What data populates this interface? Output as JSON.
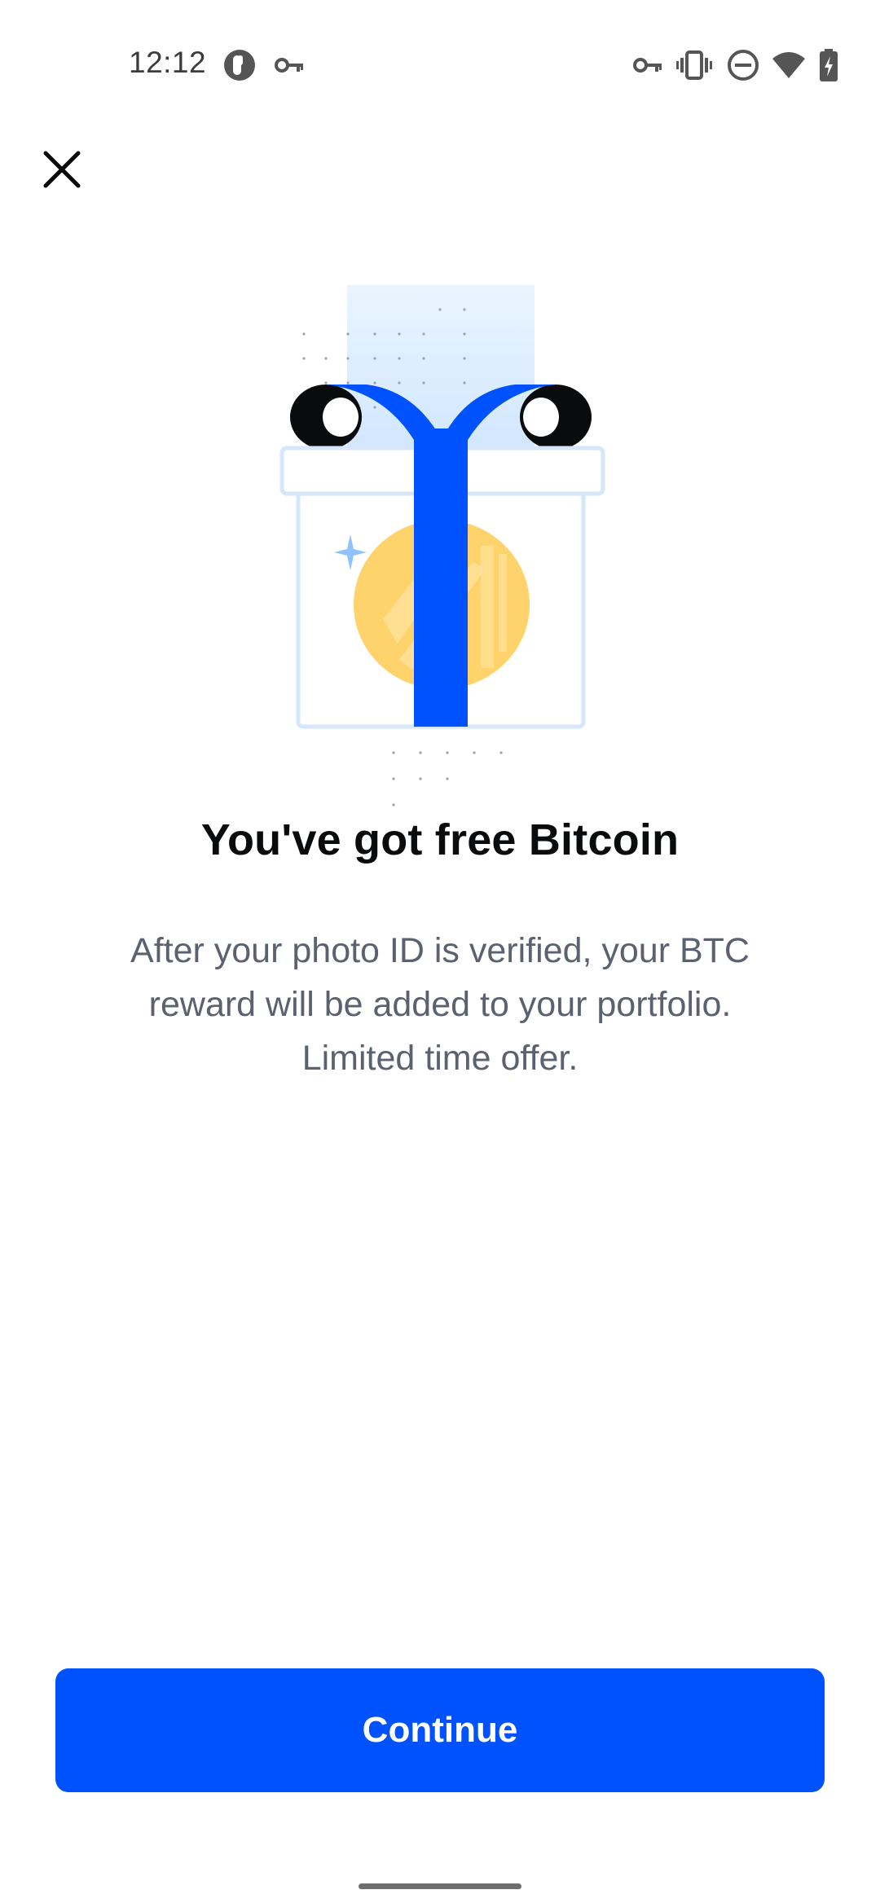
{
  "status_bar": {
    "time": "12:12",
    "left_icons": [
      "app-notification-icon",
      "vpn-key-icon"
    ],
    "right_icons": [
      "vpn-key-icon",
      "vibrate-icon",
      "do-not-disturb-icon",
      "wifi-icon",
      "battery-charging-icon"
    ]
  },
  "header": {
    "close_icon": "close-icon"
  },
  "hero": {
    "illustration": "gift-box-with-bitcoin-coin",
    "title": "You've got free Bitcoin",
    "body": "After your photo ID is verified, your BTC reward will be added to your portfolio. Limited time offer."
  },
  "actions": {
    "continue_label": "Continue"
  },
  "colors": {
    "primary": "#0052ff",
    "title": "#0a0b0d",
    "body": "#5b616e",
    "coin": "#ffd36b"
  }
}
